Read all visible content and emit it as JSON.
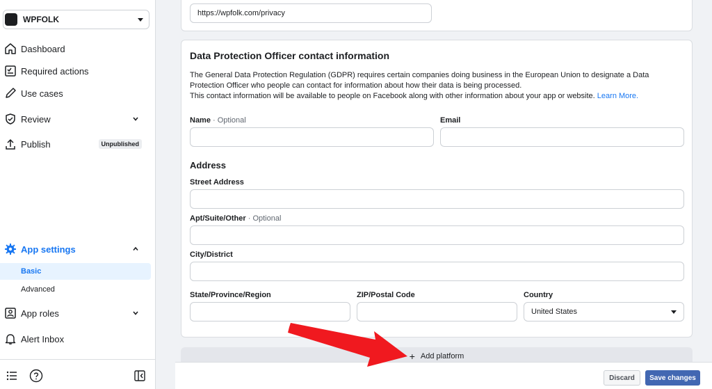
{
  "sidebar": {
    "app_name": "WPFOLK",
    "items": [
      {
        "label": "Dashboard",
        "icon": "home-icon"
      },
      {
        "label": "Required actions",
        "icon": "checklist-icon"
      },
      {
        "label": "Use cases",
        "icon": "pencil-icon"
      },
      {
        "label": "Review",
        "icon": "shield-check-icon"
      },
      {
        "label": "Publish",
        "icon": "upload-icon",
        "badge": "Unpublished"
      }
    ],
    "app_settings": {
      "label": "App settings",
      "icon": "gear-icon",
      "subitems": [
        {
          "label": "Basic",
          "selected": true
        },
        {
          "label": "Advanced",
          "selected": false
        }
      ]
    },
    "bottom_items": [
      {
        "label": "App roles",
        "icon": "id-badge-icon"
      },
      {
        "label": "Alert Inbox",
        "icon": "bell-icon"
      }
    ],
    "accent_color": "#1877f2"
  },
  "privacy": {
    "url_value": "https://wpfolk.com/privacy"
  },
  "dpo": {
    "title": "Data Protection Officer contact information",
    "desc_line1": "The General Data Protection Regulation (GDPR) requires certain companies doing business in the European Union to designate a Data Protection Officer who people can contact for information about how their data is being processed.",
    "desc_line2": "This contact information will be available to people on Facebook along with other information about your app or website.",
    "learn_more": "Learn More.",
    "name_label": "Name",
    "optional_suffix": "· Optional",
    "email_label": "Email",
    "address_title": "Address",
    "street_label": "Street Address",
    "apt_label": "Apt/Suite/Other",
    "city_label": "City/District",
    "state_label": "State/Province/Region",
    "zip_label": "ZIP/Postal Code",
    "country_label": "Country",
    "country_value": "United States"
  },
  "add_platform": {
    "label": "Add platform"
  },
  "footer": {
    "discard_label": "Discard",
    "save_label": "Save changes",
    "save_color": "#4267b2"
  },
  "annotation": {
    "arrow_color": "#f0191f"
  }
}
